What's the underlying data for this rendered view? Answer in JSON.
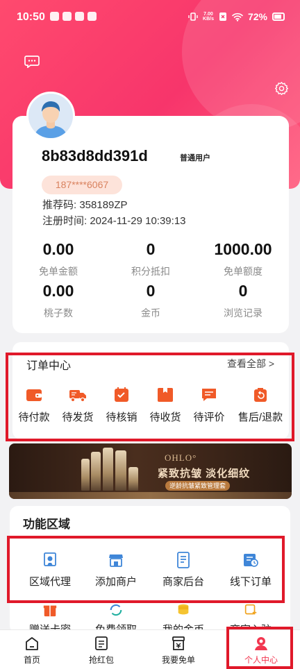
{
  "status_bar": {
    "time": "10:50",
    "speed_top": "7.00",
    "speed_bottom": "KB/s",
    "battery": "72%"
  },
  "profile": {
    "username": "8b83d8dd391d",
    "user_level": "普通用户",
    "phone": "187****6067",
    "referral": "推荐码: 358189ZP",
    "register_time": "注册时间: 2024-11-29 10:39:13"
  },
  "stats": [
    {
      "value": "0.00",
      "label": "免单金额"
    },
    {
      "value": "0",
      "label": "积分抵扣"
    },
    {
      "value": "1000.00",
      "label": "免单额度"
    },
    {
      "value": "0.00",
      "label": "桃子数"
    },
    {
      "value": "0",
      "label": "金币"
    },
    {
      "value": "0",
      "label": "浏览记录"
    }
  ],
  "orders": {
    "title": "订单中心",
    "see_all": "查看全部 >",
    "items": [
      {
        "label": "待付款",
        "icon": "wallet-icon"
      },
      {
        "label": "待发货",
        "icon": "truck-icon"
      },
      {
        "label": "待核销",
        "icon": "calendar-check-icon"
      },
      {
        "label": "待收货",
        "icon": "package-icon"
      },
      {
        "label": "待评价",
        "icon": "review-icon"
      },
      {
        "label": "售后/退款",
        "icon": "refund-icon"
      }
    ]
  },
  "banner": {
    "brand": "OHLO°",
    "slogan": "紧致抗皱 淡化细纹",
    "sub": "逆龄抗皱紧致管理套"
  },
  "functions": {
    "title": "功能区域",
    "items": [
      {
        "label": "区域代理",
        "icon": "certificate-icon"
      },
      {
        "label": "添加商户",
        "icon": "store-icon"
      },
      {
        "label": "商家后台",
        "icon": "tablet-icon"
      },
      {
        "label": "线下订单",
        "icon": "order-clock-icon"
      }
    ],
    "more_items": [
      {
        "label": "赠送卡密",
        "icon": "gift-icon"
      },
      {
        "label": "免费领取",
        "icon": "refresh-icon"
      },
      {
        "label": "我的金币",
        "icon": "coins-icon"
      },
      {
        "label": "商家入驻",
        "icon": "merchant-icon"
      }
    ]
  },
  "tabs": [
    {
      "label": "首页",
      "icon": "home-icon",
      "active": false
    },
    {
      "label": "抢红包",
      "icon": "redpacket-icon",
      "active": false
    },
    {
      "label": "我要免单",
      "icon": "free-order-icon",
      "active": false
    },
    {
      "label": "个人中心",
      "icon": "user-icon",
      "active": true
    }
  ],
  "colors": {
    "brand_pink": "#f7356b",
    "accent_orange": "#f05a28",
    "highlight_red": "#e0192a",
    "function_blue": "#3f86d8"
  }
}
